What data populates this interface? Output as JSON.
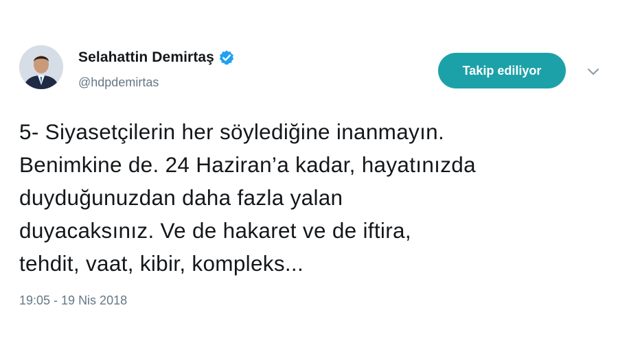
{
  "author": {
    "display_name": "Selahattin Demirtaş",
    "handle": "@hdpdemirtas",
    "verified_icon": "verified-badge-icon"
  },
  "actions": {
    "follow_label": "Takip ediliyor",
    "more_icon": "chevron-down-icon"
  },
  "tweet": {
    "lines": [
      "5- Siyasetçilerin her söylediğine inanmayın.",
      "Benimkine de. 24 Haziran’a kadar, hayatınızda",
      "duyduğunuzdan daha fazla yalan",
      "duyacaksınız. Ve de hakaret ve de iftira,",
      "tehdit, vaat, kibir, kompleks..."
    ],
    "timestamp": "19:05 - 19 Nis 2018"
  },
  "colors": {
    "follow_button": "#1da1a9",
    "verified": "#1da1f2",
    "secondary_text": "#657786",
    "primary_text": "#14171a"
  }
}
